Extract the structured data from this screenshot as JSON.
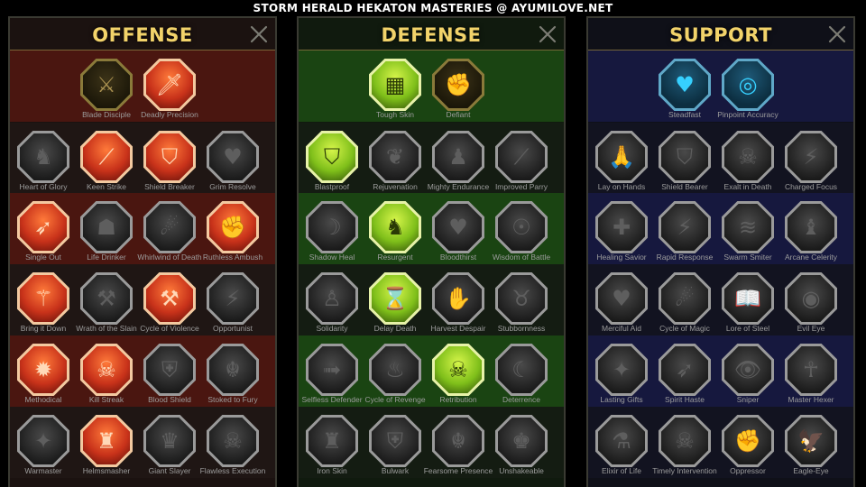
{
  "header": {
    "title": "STORM HERALD HEKATON MASTERIES @ AYUMILOVE.NET"
  },
  "colors": {
    "title_gold": "#f2d36a",
    "offense_band": "#5a1a14",
    "defense_band": "#1e4a14",
    "support_band": "#1a1a4a",
    "active_red": "#c8321a",
    "active_green": "#7fbf1a",
    "active_blue": "#36d0ff"
  },
  "panels": [
    {
      "key": "offense",
      "title": "OFFENSE",
      "close_icon": "close-icon",
      "rows": [
        [
          {
            "label": "Blade Disciple",
            "icon": "crossed-swords-icon",
            "glyph": "⚔",
            "state": "dim-gold"
          },
          {
            "label": "Deadly Precision",
            "icon": "dagger-icon",
            "glyph": "🗡",
            "state": "active-red"
          }
        ],
        [
          {
            "label": "Heart of Glory",
            "icon": "horned-heart-icon",
            "glyph": "♞",
            "state": "inactive"
          },
          {
            "label": "Keen Strike",
            "icon": "claw-slash-icon",
            "glyph": "⟋",
            "state": "active-red"
          },
          {
            "label": "Shield Breaker",
            "icon": "broken-shield-icon",
            "glyph": "⛉",
            "state": "active-red"
          },
          {
            "label": "Grim Resolve",
            "icon": "dark-heart-icon",
            "glyph": "♥",
            "state": "inactive"
          }
        ],
        [
          {
            "label": "Single Out",
            "icon": "arrows-target-icon",
            "glyph": "➶",
            "state": "active-red"
          },
          {
            "label": "Life Drinker",
            "icon": "fanged-mouth-icon",
            "glyph": "☗",
            "state": "inactive"
          },
          {
            "label": "Whirlwind of Death",
            "icon": "whirlwind-icon",
            "glyph": "☄",
            "state": "inactive"
          },
          {
            "label": "Ruthless Ambush",
            "icon": "fist-blade-icon",
            "glyph": "✊",
            "state": "active-red"
          }
        ],
        [
          {
            "label": "Bring it Down",
            "icon": "sword-down-icon",
            "glyph": "⚚",
            "state": "active-red"
          },
          {
            "label": "Wrath of the Slain",
            "icon": "hammer-icon",
            "glyph": "⚒",
            "state": "inactive"
          },
          {
            "label": "Cycle of Violence",
            "icon": "axe-icon",
            "glyph": "⚒",
            "state": "active-red"
          },
          {
            "label": "Opportunist",
            "icon": "chain-lightning-icon",
            "glyph": "⚡",
            "state": "inactive"
          }
        ],
        [
          {
            "label": "Methodical",
            "icon": "burst-icon",
            "glyph": "✹",
            "state": "active-red"
          },
          {
            "label": "Kill Streak",
            "icon": "skull-icon",
            "glyph": "☠",
            "state": "active-red"
          },
          {
            "label": "Blood Shield",
            "icon": "sword-shield-icon",
            "glyph": "⛨",
            "state": "inactive"
          },
          {
            "label": "Stoked to Fury",
            "icon": "rage-figure-icon",
            "glyph": "☬",
            "state": "inactive"
          }
        ],
        [
          {
            "label": "Warmaster",
            "icon": "glowing-sword-icon",
            "glyph": "✦",
            "state": "inactive"
          },
          {
            "label": "Helmsmasher",
            "icon": "knight-helm-icon",
            "glyph": "♜",
            "state": "active-red"
          },
          {
            "label": "Giant Slayer",
            "icon": "giant-icon",
            "glyph": "♛",
            "state": "inactive"
          },
          {
            "label": "Flawless Execution",
            "icon": "skull-blade-icon",
            "glyph": "☠",
            "state": "inactive"
          }
        ]
      ]
    },
    {
      "key": "defense",
      "title": "DEFENSE",
      "close_icon": "close-icon",
      "rows": [
        [
          {
            "label": "Tough Skin",
            "icon": "scales-icon",
            "glyph": "▦",
            "state": "active-green"
          },
          {
            "label": "Defiant",
            "icon": "raised-fist-icon",
            "glyph": "✊",
            "state": "dim-gold"
          }
        ],
        [
          {
            "label": "Blastproof",
            "icon": "chevron-shield-icon",
            "glyph": "⛉",
            "state": "active-green"
          },
          {
            "label": "Rejuvenation",
            "icon": "heart-hand-icon",
            "glyph": "❦",
            "state": "inactive"
          },
          {
            "label": "Mighty Endurance",
            "icon": "muscle-figure-icon",
            "glyph": "♟",
            "state": "inactive"
          },
          {
            "label": "Improved Parry",
            "icon": "parry-blades-icon",
            "glyph": "⟋",
            "state": "inactive"
          }
        ],
        [
          {
            "label": "Shadow Heal",
            "icon": "shadow-figure-icon",
            "glyph": "☽",
            "state": "inactive"
          },
          {
            "label": "Resurgent",
            "icon": "knight-shield-icon",
            "glyph": "♞",
            "state": "active-green"
          },
          {
            "label": "Bloodthirst",
            "icon": "heart-skull-icon",
            "glyph": "♥",
            "state": "inactive"
          },
          {
            "label": "Wisdom of Battle",
            "icon": "head-aura-icon",
            "glyph": "☉",
            "state": "inactive"
          }
        ],
        [
          {
            "label": "Solidarity",
            "icon": "group-icon",
            "glyph": "♙",
            "state": "inactive"
          },
          {
            "label": "Delay Death",
            "icon": "hourglass-icon",
            "glyph": "⌛",
            "state": "active-green"
          },
          {
            "label": "Harvest Despair",
            "icon": "open-hand-icon",
            "glyph": "✋",
            "state": "inactive"
          },
          {
            "label": "Stubbornness",
            "icon": "bull-icon",
            "glyph": "♉",
            "state": "inactive"
          }
        ],
        [
          {
            "label": "Selfless Defender",
            "icon": "runner-icon",
            "glyph": "➟",
            "state": "inactive"
          },
          {
            "label": "Cycle of Revenge",
            "icon": "flames-icon",
            "glyph": "♨",
            "state": "inactive"
          },
          {
            "label": "Retribution",
            "icon": "skull-burst-icon",
            "glyph": "☠",
            "state": "active-green"
          },
          {
            "label": "Deterrence",
            "icon": "crescent-slash-icon",
            "glyph": "☾",
            "state": "inactive"
          }
        ],
        [
          {
            "label": "Iron Skin",
            "icon": "armored-man-icon",
            "glyph": "♜",
            "state": "inactive"
          },
          {
            "label": "Bulwark",
            "icon": "bulwark-shield-icon",
            "glyph": "⛨",
            "state": "inactive"
          },
          {
            "label": "Fearsome Presence",
            "icon": "demon-mask-icon",
            "glyph": "☬",
            "state": "inactive"
          },
          {
            "label": "Unshakeable",
            "icon": "strong-figure-icon",
            "glyph": "♚",
            "state": "inactive"
          }
        ]
      ]
    },
    {
      "key": "support",
      "title": "SUPPORT",
      "close_icon": "close-icon",
      "rows": [
        [
          {
            "label": "Steadfast",
            "icon": "heart-hands-icon",
            "glyph": "♥",
            "state": "active-blue"
          },
          {
            "label": "Pinpoint Accuracy",
            "icon": "target-hand-icon",
            "glyph": "◎",
            "state": "active-blue"
          }
        ],
        [
          {
            "label": "Lay on Hands",
            "icon": "praying-hands-icon",
            "glyph": "🙏",
            "state": "inactive"
          },
          {
            "label": "Shield Bearer",
            "icon": "round-shield-icon",
            "glyph": "⛉",
            "state": "inactive"
          },
          {
            "label": "Exalt in Death",
            "icon": "skull-smoke-icon",
            "glyph": "☠",
            "state": "inactive"
          },
          {
            "label": "Charged Focus",
            "icon": "charged-hand-icon",
            "glyph": "⚡",
            "state": "inactive"
          }
        ],
        [
          {
            "label": "Healing Savior",
            "icon": "healer-figure-icon",
            "glyph": "✚",
            "state": "inactive"
          },
          {
            "label": "Rapid Response",
            "icon": "lightning-shield-icon",
            "glyph": "⚡",
            "state": "inactive"
          },
          {
            "label": "Swarm Smiter",
            "icon": "tornado-icon",
            "glyph": "≋",
            "state": "inactive"
          },
          {
            "label": "Arcane Celerity",
            "icon": "hooded-figure-icon",
            "glyph": "♝",
            "state": "inactive"
          }
        ],
        [
          {
            "label": "Merciful Aid",
            "icon": "chained-heart-icon",
            "glyph": "♥",
            "state": "inactive"
          },
          {
            "label": "Cycle of Magic",
            "icon": "comet-icon",
            "glyph": "☄",
            "state": "inactive"
          },
          {
            "label": "Lore of Steel",
            "icon": "open-book-icon",
            "glyph": "📖",
            "state": "inactive"
          },
          {
            "label": "Evil Eye",
            "icon": "evil-eye-icon",
            "glyph": "◉",
            "state": "inactive"
          }
        ],
        [
          {
            "label": "Lasting Gifts",
            "icon": "compass-star-icon",
            "glyph": "✦",
            "state": "inactive"
          },
          {
            "label": "Spirit Haste",
            "icon": "winged-boot-icon",
            "glyph": "➶",
            "state": "inactive"
          },
          {
            "label": "Sniper",
            "icon": "eye-target-icon",
            "glyph": "👁",
            "state": "inactive"
          },
          {
            "label": "Master Hexer",
            "icon": "hex-figure-icon",
            "glyph": "☥",
            "state": "inactive"
          }
        ],
        [
          {
            "label": "Elixir of Life",
            "icon": "potion-icon",
            "glyph": "⚗",
            "state": "inactive"
          },
          {
            "label": "Timely Intervention",
            "icon": "skull-claw-icon",
            "glyph": "☠",
            "state": "inactive"
          },
          {
            "label": "Oppressor",
            "icon": "crushing-fist-icon",
            "glyph": "✊",
            "state": "inactive"
          },
          {
            "label": "Eagle-Eye",
            "icon": "eagle-head-icon",
            "glyph": "🦅",
            "state": "inactive"
          }
        ]
      ]
    }
  ]
}
